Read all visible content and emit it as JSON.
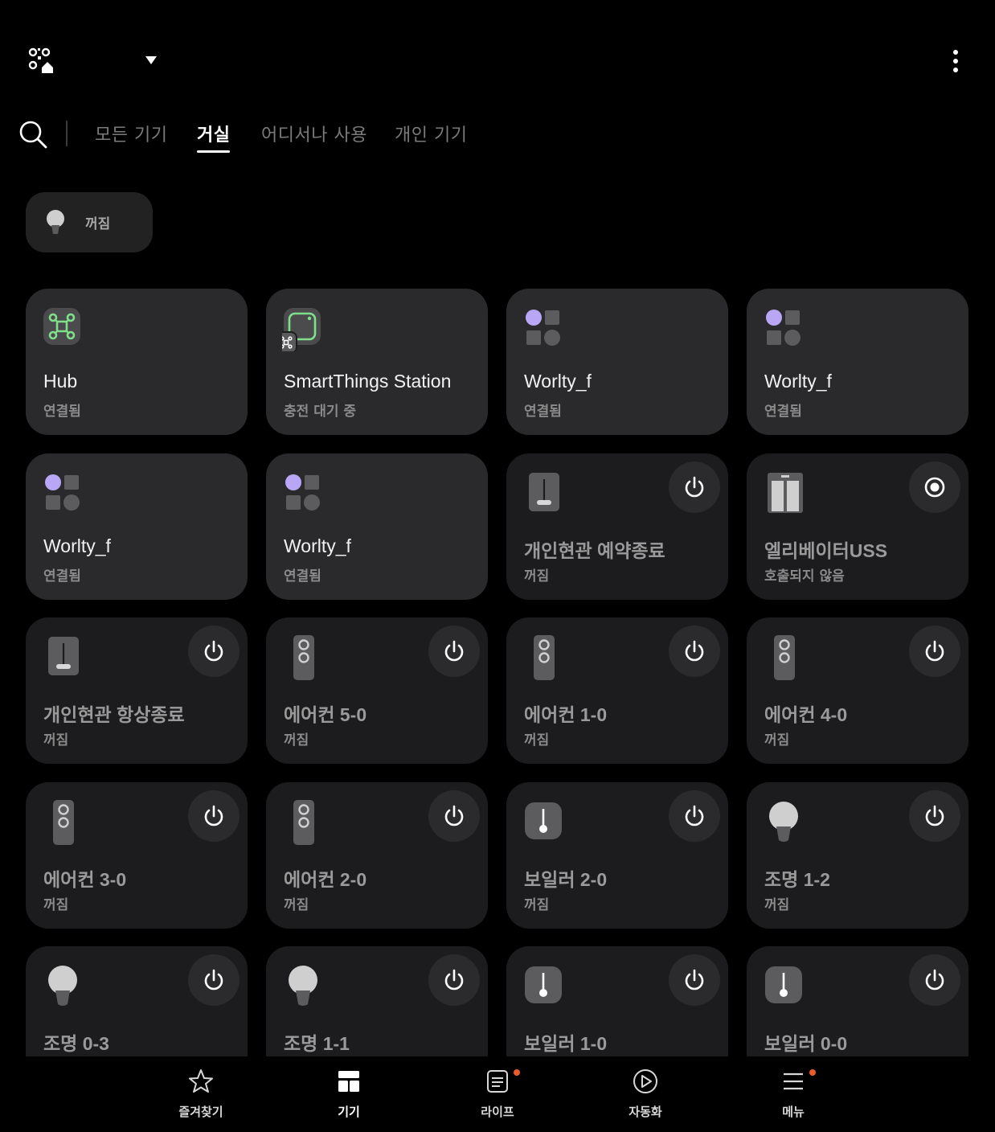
{
  "header": {
    "home_icon": "home-qr-icon",
    "dropdown_icon": "caret-down-icon",
    "more_icon": "more-vertical-icon"
  },
  "tabs": {
    "search_icon": "search-icon",
    "items": [
      {
        "label": "모든 기기",
        "active": false
      },
      {
        "label": "거실",
        "active": true
      },
      {
        "label": "어디서나 사용",
        "active": false
      },
      {
        "label": "개인 기기",
        "active": false
      }
    ]
  },
  "scene_chip": {
    "label": "꺼짐",
    "icon": "bulb-icon"
  },
  "devices": [
    {
      "name": "Hub",
      "status": "연결됨",
      "icon": "hub-icon",
      "power": false
    },
    {
      "name": "SmartThings Station",
      "status": "충전 대기 중",
      "icon": "station-icon",
      "power": false
    },
    {
      "name": "Worlty_f",
      "status": "연결됨",
      "icon": "shapes-icon",
      "power": false
    },
    {
      "name": "Worlty_f",
      "status": "연결됨",
      "icon": "shapes-icon",
      "power": false
    },
    {
      "name": "Worlty_f",
      "status": "연결됨",
      "icon": "shapes-icon",
      "power": false
    },
    {
      "name": "Worlty_f",
      "status": "연결됨",
      "icon": "shapes-icon",
      "power": false
    },
    {
      "name": "개인현관 예약종료",
      "status": "꺼짐",
      "icon": "switch-icon",
      "power": true
    },
    {
      "name": "엘리베이터USS",
      "status": "호출되지 않음",
      "icon": "elevator-icon",
      "power": true
    },
    {
      "name": "개인현관 항상종료",
      "status": "꺼짐",
      "icon": "switch-icon",
      "power": true
    },
    {
      "name": "에어컨 5-0",
      "status": "꺼짐",
      "icon": "air-conditioner-icon",
      "power": true
    },
    {
      "name": "에어컨 1-0",
      "status": "꺼짐",
      "icon": "air-conditioner-icon",
      "power": true
    },
    {
      "name": "에어컨 4-0",
      "status": "꺼짐",
      "icon": "air-conditioner-icon",
      "power": true
    },
    {
      "name": "에어컨 3-0",
      "status": "꺼짐",
      "icon": "air-conditioner-icon",
      "power": true
    },
    {
      "name": "에어컨 2-0",
      "status": "꺼짐",
      "icon": "air-conditioner-icon",
      "power": true
    },
    {
      "name": "보일러 2-0",
      "status": "꺼짐",
      "icon": "thermostat-icon",
      "power": true
    },
    {
      "name": "조명 1-2",
      "status": "꺼짐",
      "icon": "bulb-icon",
      "power": true
    },
    {
      "name": "조명 0-3",
      "status": "",
      "icon": "bulb-icon",
      "power": true
    },
    {
      "name": "조명 1-1",
      "status": "",
      "icon": "bulb-icon",
      "power": true
    },
    {
      "name": "보일러 1-0",
      "status": "",
      "icon": "thermostat-icon",
      "power": true
    },
    {
      "name": "보일러 0-0",
      "status": "",
      "icon": "thermostat-icon",
      "power": true
    }
  ],
  "bottom_nav": [
    {
      "label": "즐겨찾기",
      "icon": "star-icon",
      "badge": false
    },
    {
      "label": "기기",
      "icon": "devices-grid-icon",
      "badge": false
    },
    {
      "label": "라이프",
      "icon": "life-icon",
      "badge": true
    },
    {
      "label": "자동화",
      "icon": "play-circle-icon",
      "badge": false
    },
    {
      "label": "메뉴",
      "icon": "menu-icon",
      "badge": true
    }
  ],
  "colors": {
    "background": "#000000",
    "card": "#1c1c1e",
    "card_on": "#2a2a2c",
    "accent_purple": "#b9a7f5",
    "hub_green": "#7ee08a",
    "badge": "#f05a28"
  }
}
